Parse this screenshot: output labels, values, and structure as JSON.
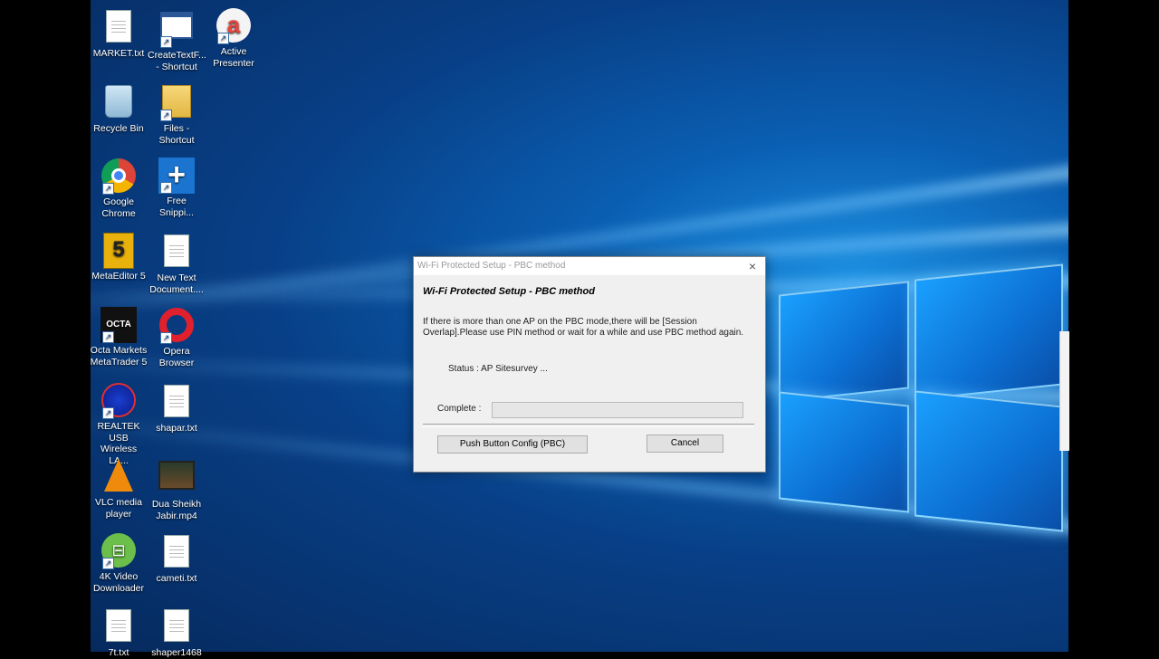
{
  "desktop": {
    "icons": [
      {
        "label1": "MARKET.txt",
        "label2": "",
        "kind": "txt"
      },
      {
        "label1": "CreateTextF...",
        "label2": "- Shortcut",
        "kind": "window"
      },
      {
        "label1": "Active",
        "label2": "Presenter",
        "kind": "active"
      },
      {
        "label1": "Recycle Bin",
        "label2": "",
        "kind": "bin"
      },
      {
        "label1": "Files -",
        "label2": "Shortcut",
        "kind": "folder"
      },
      {
        "label1": "Google",
        "label2": "Chrome",
        "kind": "chrome"
      },
      {
        "label1": "Free",
        "label2": "Snippi...",
        "kind": "plus"
      },
      {
        "label1": "MetaEditor 5",
        "label2": "",
        "kind": "meta"
      },
      {
        "label1": "New Text",
        "label2": "Document....",
        "kind": "txt"
      },
      {
        "label1": "Octa Markets",
        "label2": "MetaTrader 5",
        "kind": "octa"
      },
      {
        "label1": "Opera",
        "label2": "Browser",
        "kind": "opera"
      },
      {
        "label1": "REALTEK USB",
        "label2": "Wireless LA...",
        "kind": "realtek"
      },
      {
        "label1": "shapar.txt",
        "label2": "",
        "kind": "txt"
      },
      {
        "label1": "VLC media",
        "label2": "player",
        "kind": "vlc"
      },
      {
        "label1": "Dua Sheikh",
        "label2": "Jabir.mp4",
        "kind": "video"
      },
      {
        "label1": "4K Video",
        "label2": "Downloader",
        "kind": "4k"
      },
      {
        "label1": "cameti.txt",
        "label2": "",
        "kind": "txt"
      },
      {
        "label1": "7t.txt",
        "label2": "",
        "kind": "txt"
      },
      {
        "label1": "shaper1468",
        "label2": "",
        "kind": "txt"
      }
    ]
  },
  "dialog": {
    "title": "Wi-Fi Protected Setup - PBC method",
    "heading": "Wi-Fi Protected Setup - PBC method",
    "message": "If there is more than one AP on the PBC mode,there will be [Session Overlap].Please use PIN method or wait for a while and use PBC method again.",
    "status": "Status : AP Sitesurvey ...",
    "complete_label": "Complete :",
    "progress": 0,
    "pbc_button": "Push Button Config (PBC)",
    "cancel_button": "Cancel",
    "close_icon": "×"
  },
  "colors": {
    "dialog_bg": "#f0f0f0",
    "desktop_blue": "#0a5fb3"
  }
}
